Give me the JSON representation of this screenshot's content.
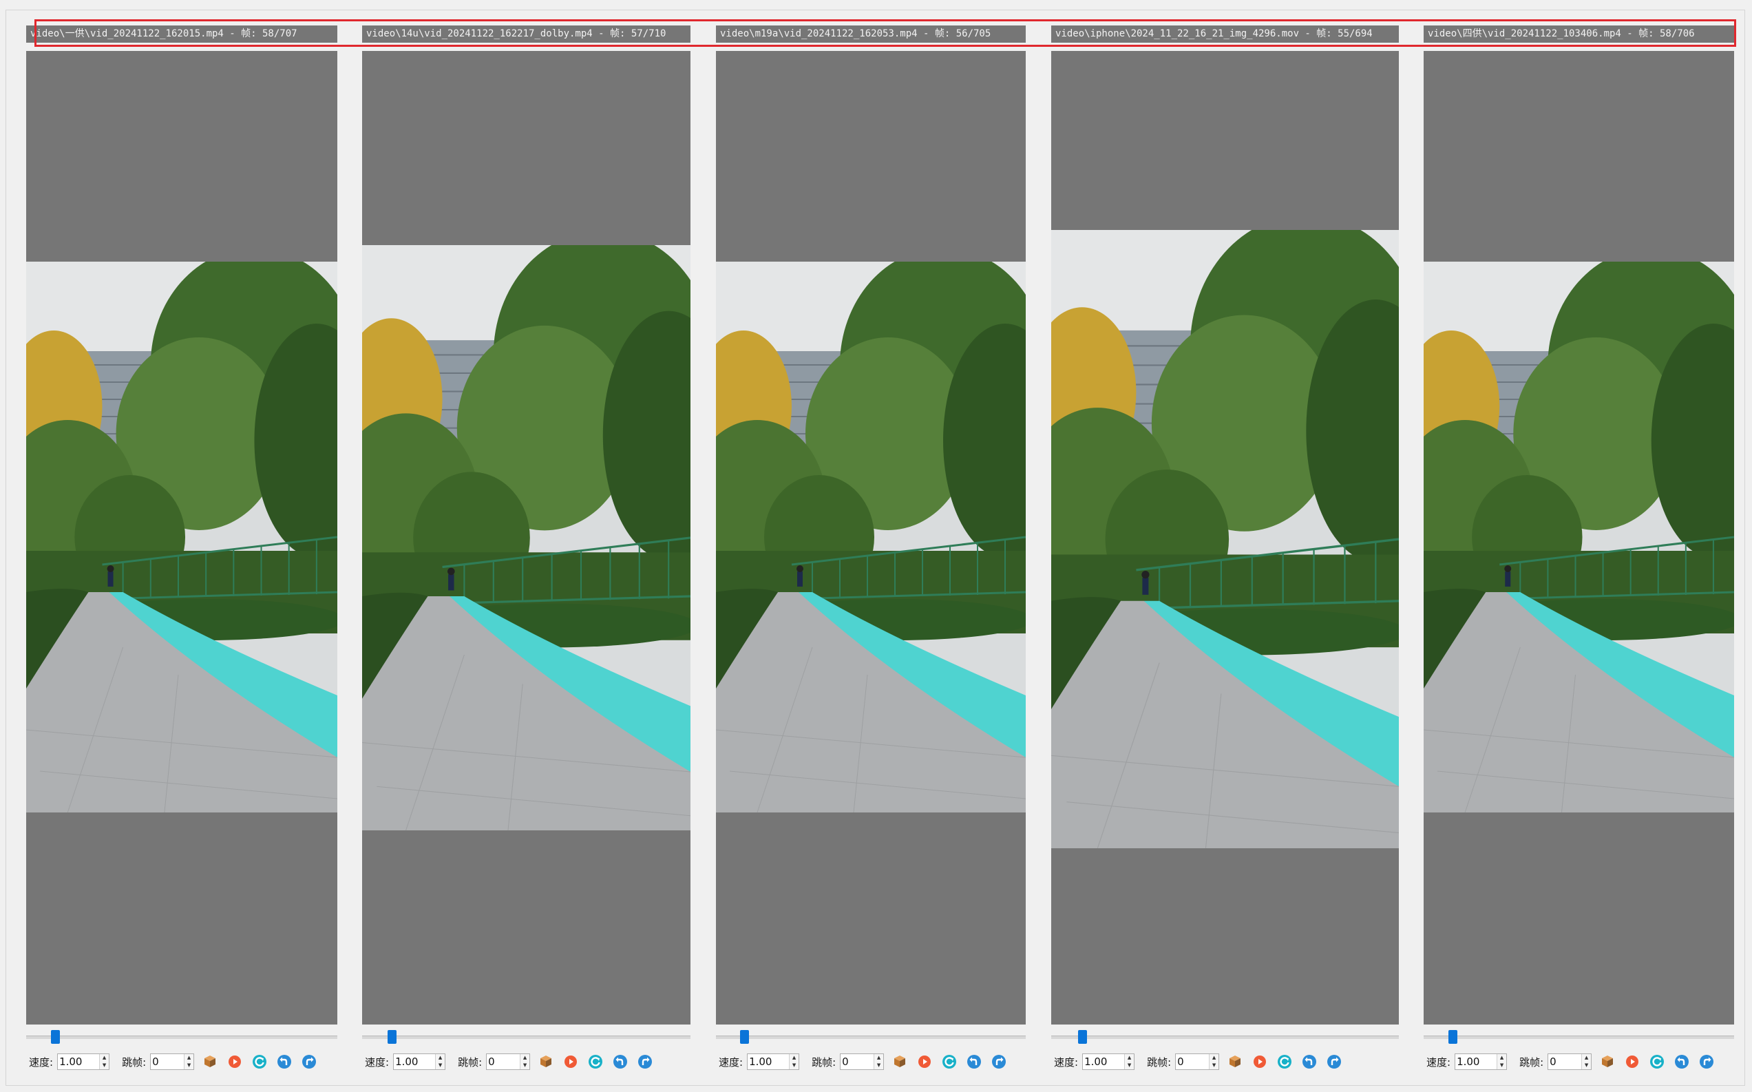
{
  "panels": [
    {
      "id": "p1",
      "title": "video\\一供\\vid_20241122_162015.mp4 - 帧: 58/707",
      "speed_label": "速度:",
      "speed_value": "1.00",
      "skip_label": "跳帧:",
      "skip_value": "0",
      "progress": 0.082
    },
    {
      "id": "p2",
      "title": "video\\14u\\vid_20241122_162217_dolby.mp4 - 帧: 57/710",
      "speed_label": "速度:",
      "speed_value": "1.00",
      "skip_label": "跳帧:",
      "skip_value": "0",
      "progress": 0.08
    },
    {
      "id": "p3",
      "title": "video\\m19a\\vid_20241122_162053.mp4 - 帧: 56/705",
      "speed_label": "速度:",
      "speed_value": "1.00",
      "skip_label": "跳帧:",
      "skip_value": "0",
      "progress": 0.079
    },
    {
      "id": "p4",
      "title": "video\\iphone\\2024_11_22_16_21_img_4296.mov - 帧: 55/694",
      "speed_label": "速度:",
      "speed_value": "1.00",
      "skip_label": "跳帧:",
      "skip_value": "0",
      "progress": 0.079
    },
    {
      "id": "p5",
      "title": "video\\四供\\vid_20241122_103406.mp4 - 帧: 58/706",
      "speed_label": "速度:",
      "speed_value": "1.00",
      "skip_label": "跳帧:",
      "skip_value": "0",
      "progress": 0.082
    }
  ],
  "icons": [
    "3d-box-icon",
    "play-record-icon",
    "reset-circle-icon",
    "undo-icon",
    "redo-icon"
  ],
  "colors": {
    "panel_bg": "#767676",
    "title_text": "#f2f2f2",
    "highlight": "#e0282e",
    "thumb": "#0a74d8",
    "path_cyan": "#4fd3d0"
  }
}
